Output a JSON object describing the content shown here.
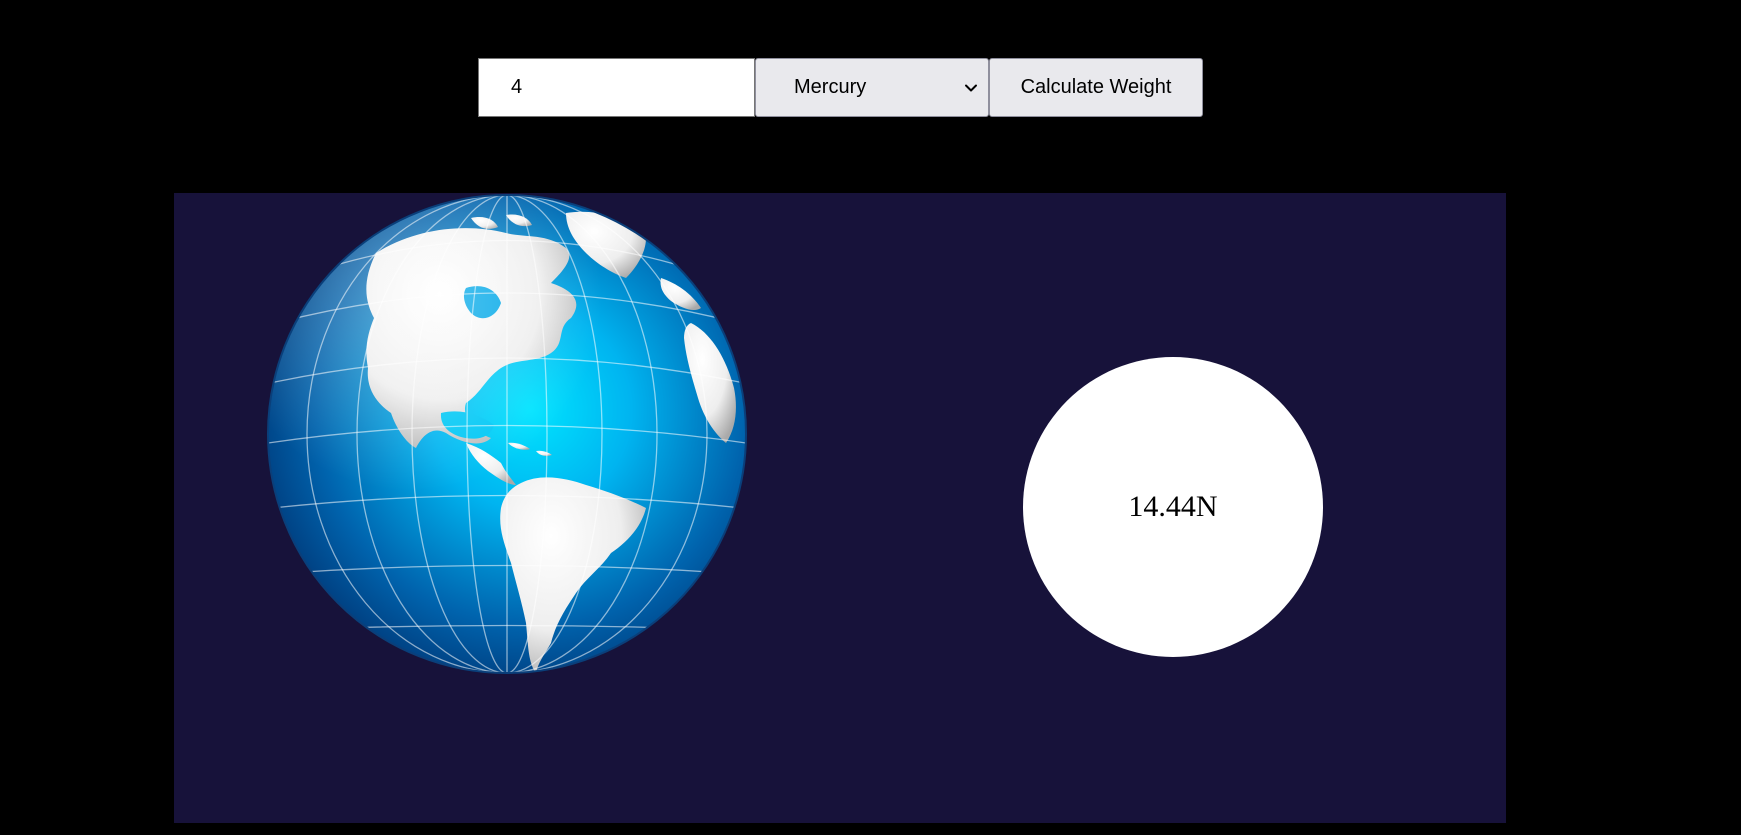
{
  "form": {
    "mass_value": "4",
    "planet_selected": "Mercury",
    "calculate_label": "Calculate Weight"
  },
  "result": {
    "weight_text": "14.44N"
  },
  "icons": {
    "dropdown": "chevron-down-icon",
    "planet_image": "earth-globe-icon"
  },
  "colors": {
    "page_background": "#000000",
    "stage_background": "#17123a",
    "result_circle": "#ffffff",
    "control_background": "#e9e9ed"
  }
}
